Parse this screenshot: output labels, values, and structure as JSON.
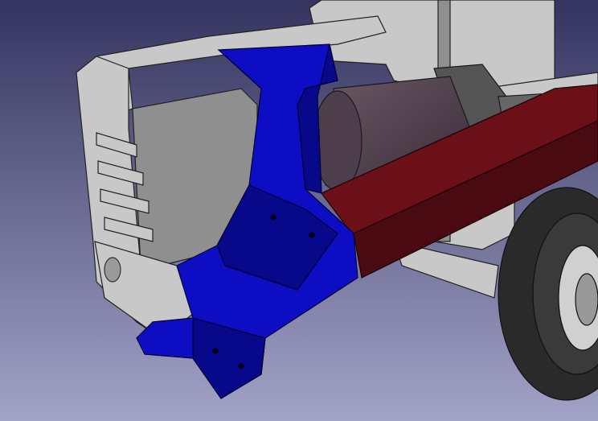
{
  "viewport": {
    "background_top": "#34345f",
    "background_bottom": "#a3a3c8"
  },
  "parts": {
    "bracket_color": "#0d0dc4",
    "bracket_shade": "#08088a",
    "beam_color": "#6b0f19",
    "beam_shade": "#4a0a12",
    "frame_color": "#c8c8c8",
    "frame_shade": "#8f8f8f",
    "cylinder_color": "#4e3d4a",
    "tire_color": "#2a2a2a",
    "hub_color": "#d0d0d0"
  }
}
